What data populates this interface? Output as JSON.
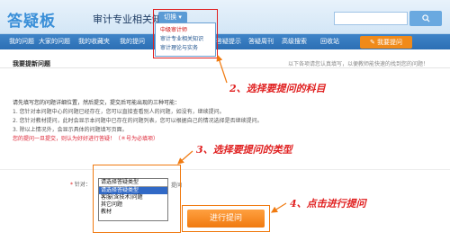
{
  "header": {
    "logo": "答疑板",
    "site_title": "审计专业相关知识",
    "switch_label": "切换 ▾",
    "search_placeholder": ""
  },
  "switch_menu": {
    "items": [
      "中级审计师",
      "审计专业相关知识",
      "审计理论与实务"
    ]
  },
  "nav": {
    "items": [
      "我的问题",
      "大家的问题",
      "我的收藏夹",
      "我的提问",
      "答疑提示",
      "答疑周刊",
      "高级搜索",
      "回收站"
    ],
    "ask_button": "我要提问"
  },
  "breadcrumb": {
    "title": "我要提新问题",
    "hint": "以下各项请您认真填写，以便教师能快速的找到您的问题！"
  },
  "notes": {
    "head": "请先填写您的问题详细位置，然后提交，提交后可能出现的三种可能：",
    "lines": [
      "1. 您针对本问题中心的问题已经存在，您可以直接查看别人的问题，如没有，继续提问。",
      "2. 您针对教材提问，此时会显示本问题中已存在的问题列表，您可以根据自己的情况选择是否继续提问。",
      "3. 除以上情况外，会显示具体的问题填写页面。",
      "您的提问一旦提交，则认为好好进行答疑！（＊号为必填项）"
    ]
  },
  "annotations": {
    "step2": "2、选择要提问的科目",
    "step3": "3、选择要提问的类型",
    "step4": "4、点击进行提问"
  },
  "form": {
    "label": "针对：",
    "star": "*",
    "select_current": "请选择答疑类型",
    "options": [
      "请选择答疑类型",
      "客服(含技术)问题",
      "其它问题",
      "教材"
    ],
    "extra_label": "提问"
  },
  "submit_button": "进行提问",
  "colors": {
    "accent": "#3f84c8",
    "orange": "#f07a10",
    "annotation_red": "#e02020"
  }
}
